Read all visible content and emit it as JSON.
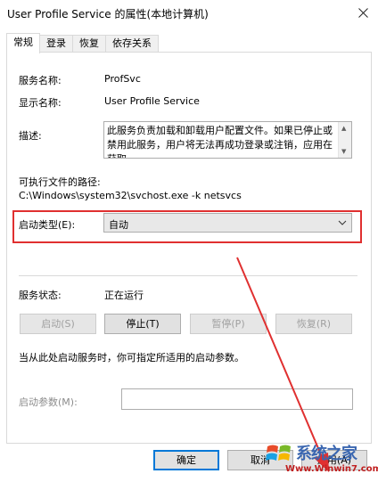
{
  "window": {
    "title": "User Profile Service 的属性(本地计算机)"
  },
  "tabs": [
    {
      "label": "常规",
      "active": true
    },
    {
      "label": "登录"
    },
    {
      "label": "恢复"
    },
    {
      "label": "依存关系"
    }
  ],
  "general": {
    "service_name_label": "服务名称:",
    "service_name": "ProfSvc",
    "display_name_label": "显示名称:",
    "display_name": "User Profile Service",
    "description_label": "描述:",
    "description": "此服务负责加载和卸载用户配置文件。如果已停止或禁用此服务，用户将无法再成功登录或注销，应用在获取",
    "path_label": "可执行文件的路径:",
    "path": "C:\\Windows\\system32\\svchost.exe -k netsvcs",
    "startup_type_label": "启动类型(E):",
    "startup_type_value": "自动",
    "status_label": "服务状态:",
    "status_value": "正在运行",
    "buttons": {
      "start": "启动(S)",
      "stop": "停止(T)",
      "pause": "暂停(P)",
      "resume": "恢复(R)"
    },
    "hint": "当从此处启动服务时，你可指定所适用的启动参数。",
    "param_label": "启动参数(M):"
  },
  "footer": {
    "ok": "确定",
    "cancel": "取消",
    "apply": "应用(A)"
  },
  "watermark": {
    "brand": "系统之家",
    "url": "Www.Winwin7.com"
  },
  "colors": {
    "highlight_red": "#e03030",
    "accent_blue": "#0078d7"
  }
}
